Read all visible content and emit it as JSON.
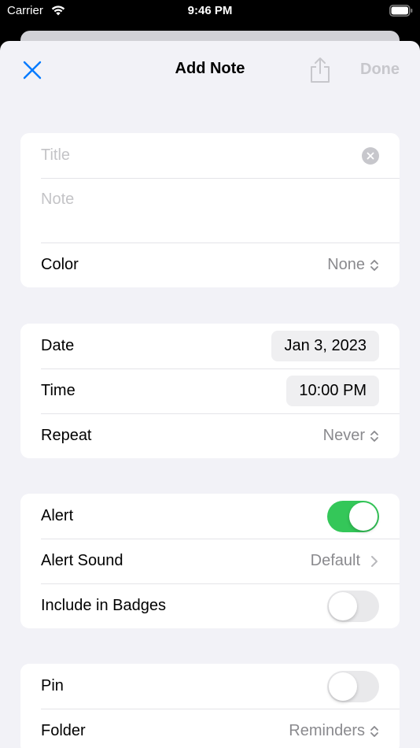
{
  "status_bar": {
    "carrier": "Carrier",
    "time": "9:46 PM"
  },
  "nav": {
    "title": "Add Note",
    "done_label": "Done",
    "accent_color": "#007aff"
  },
  "note_group": {
    "title_placeholder": "Title",
    "note_placeholder": "Note",
    "color_label": "Color",
    "color_value": "None"
  },
  "schedule_group": {
    "date_label": "Date",
    "date_value": "Jan 3, 2023",
    "time_label": "Time",
    "time_value": "10:00 PM",
    "repeat_label": "Repeat",
    "repeat_value": "Never"
  },
  "alert_group": {
    "alert_label": "Alert",
    "alert_on": true,
    "sound_label": "Alert Sound",
    "sound_value": "Default",
    "badges_label": "Include in Badges",
    "badges_on": false
  },
  "pin_group": {
    "pin_label": "Pin",
    "pin_on": false,
    "folder_label": "Folder",
    "folder_value": "Reminders"
  }
}
